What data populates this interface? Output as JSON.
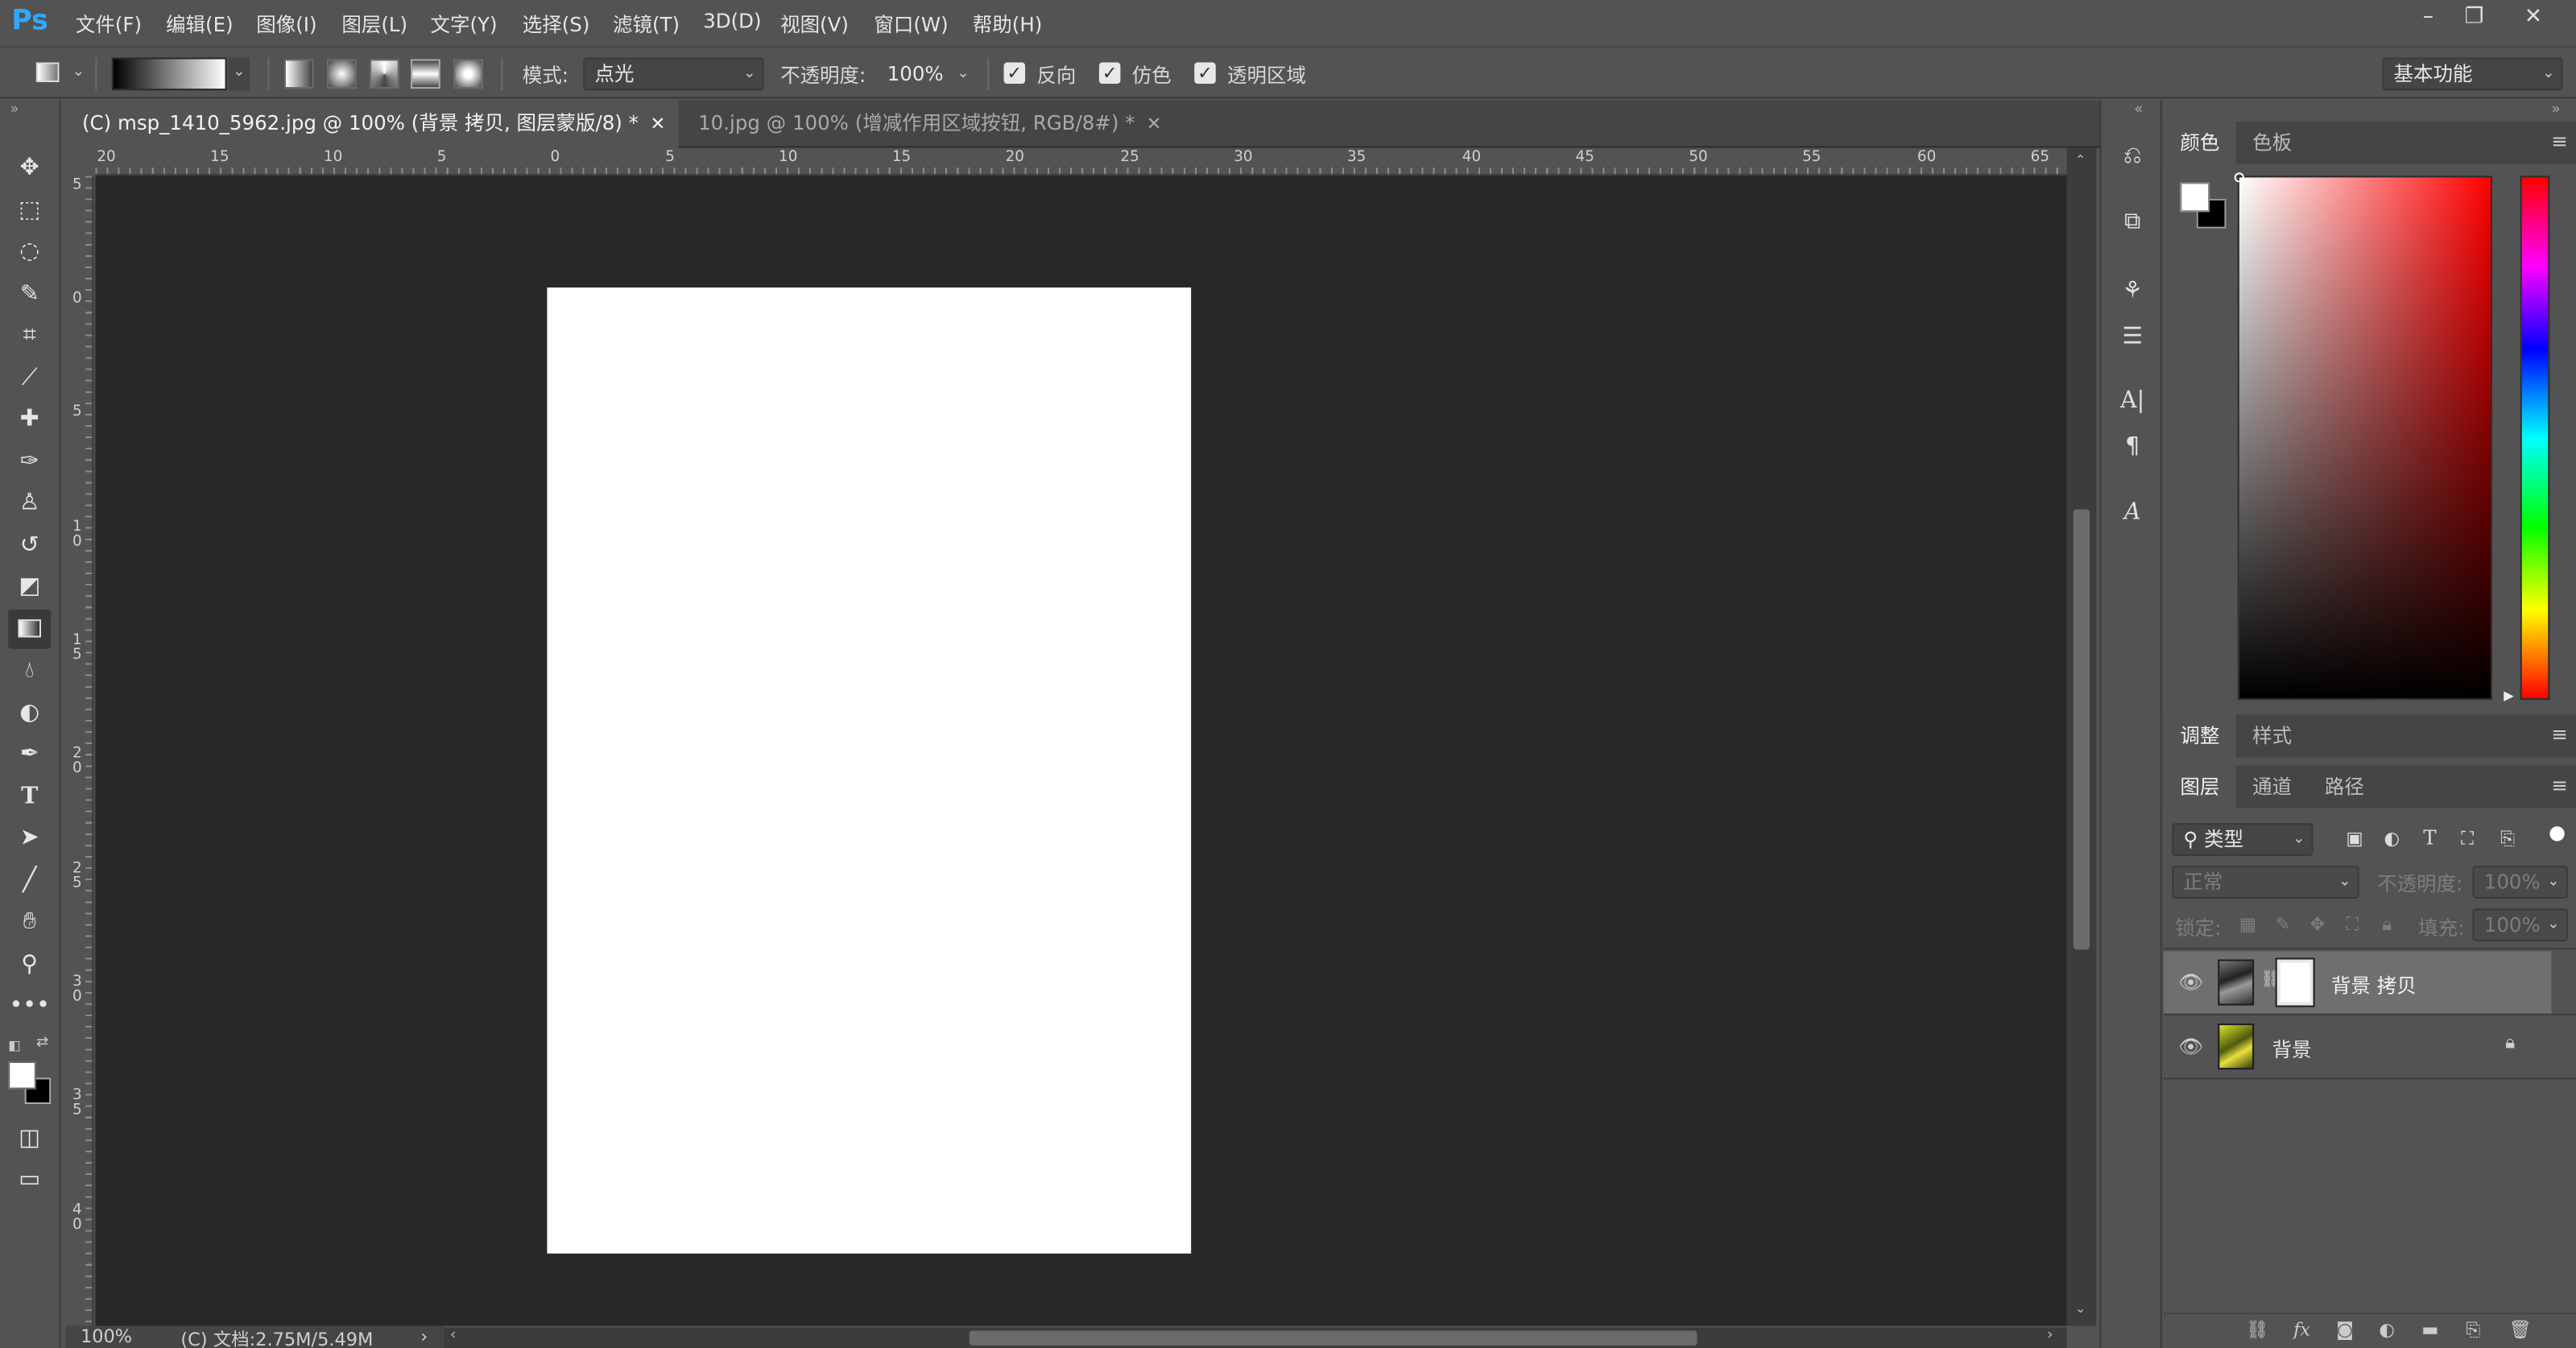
{
  "app": {
    "logo": "Ps"
  },
  "menu": [
    "文件(F)",
    "编辑(E)",
    "图像(I)",
    "图层(L)",
    "文字(Y)",
    "选择(S)",
    "滤镜(T)",
    "3D(D)",
    "视图(V)",
    "窗口(W)",
    "帮助(H)"
  ],
  "window_controls": {
    "minimize": "–",
    "restore": "❐",
    "close": "✕"
  },
  "options": {
    "mode_label": "模式:",
    "mode_value": "点光",
    "opacity_label": "不透明度:",
    "opacity_value": "100%",
    "reverse_label": "反向",
    "reverse_checked": true,
    "dither_label": "仿色",
    "dither_checked": true,
    "transparency_label": "透明区域",
    "transparency_checked": true,
    "workspace": "基本功能"
  },
  "tabs": [
    {
      "label": "(C) msp_1410_5962.jpg  @  100% (背景 拷贝, 图层蒙版/8) *",
      "active": true
    },
    {
      "label": "10.jpg  @  100% (增减作用区域按钮, RGB/8#) *",
      "active": false
    }
  ],
  "ruler_top": [
    "20",
    "15",
    "10",
    "5",
    "0",
    "5",
    "10",
    "15",
    "20",
    "25",
    "30",
    "35",
    "40",
    "45",
    "50",
    "55",
    "60",
    "65"
  ],
  "ruler_left": [
    "5",
    "0",
    "5",
    "10",
    "15",
    "20",
    "25",
    "30",
    "35",
    "40"
  ],
  "status": {
    "zoom": "100%",
    "doc": "(C) 文档:2.75M/5.49M"
  },
  "tools": [
    "move-icon",
    "marquee-icon",
    "lasso-icon",
    "quick-select-icon",
    "crop-icon",
    "eyedropper-icon",
    "healing-icon",
    "brush-icon",
    "stamp-icon",
    "history-brush-icon",
    "eraser-icon",
    "gradient-icon",
    "blur-icon",
    "dodge-icon",
    "pen-icon",
    "type-icon",
    "path-select-icon",
    "line-icon",
    "hand-icon",
    "zoom-icon",
    "more-icon"
  ],
  "colors": {
    "foreground": "#ffffff",
    "background": "#000000",
    "accent": "#31a8ff"
  },
  "panels": {
    "color_tabs": [
      "颜色",
      "色板"
    ],
    "adjust_tabs": [
      "调整",
      "样式"
    ],
    "layer_tabs": [
      "图层",
      "通道",
      "路径"
    ],
    "filter_kind": "类型",
    "blend_mode": "正常",
    "opacity_label": "不透明度:",
    "opacity_value": "100%",
    "lock_label": "锁定:",
    "fill_label": "填充:",
    "fill_value": "100%",
    "layers": [
      {
        "name": "背景 拷贝",
        "selected": true,
        "has_mask": true,
        "locked": false
      },
      {
        "name": "背景",
        "selected": false,
        "has_mask": false,
        "locked": true
      }
    ]
  }
}
